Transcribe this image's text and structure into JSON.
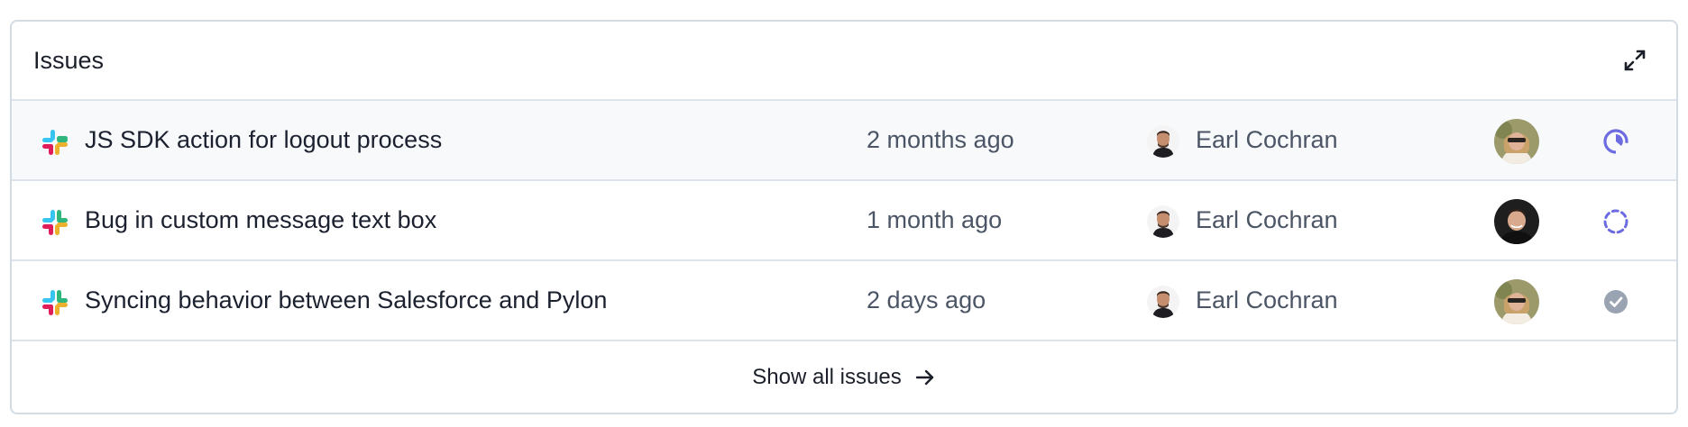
{
  "card": {
    "title": "Issues"
  },
  "issues": [
    {
      "title": "JS SDK action for logout process",
      "time": "2 months ago",
      "assignee": "Earl Cochran",
      "status_icon": "in-progress-icon"
    },
    {
      "title": "Bug in custom message text box",
      "time": "1 month ago",
      "assignee": "Earl Cochran",
      "status_icon": "pending-icon"
    },
    {
      "title": "Syncing behavior between Salesforce and Pylon",
      "time": "2 days ago",
      "assignee": "Earl Cochran",
      "status_icon": "done-check-icon"
    }
  ],
  "footer": {
    "label": "Show all issues"
  },
  "colors": {
    "status_purple": "#6c6ce0",
    "status_done": "#9aa3b2",
    "border": "#d3dbe3"
  }
}
